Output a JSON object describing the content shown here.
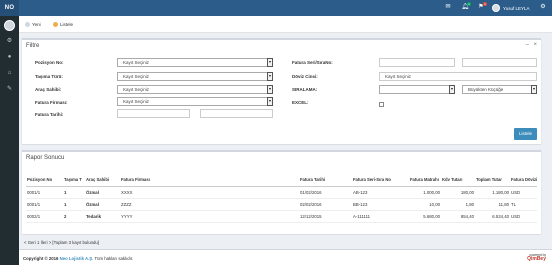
{
  "app": {
    "logo": "NO"
  },
  "topbar": {
    "mail_icon": "envelope-icon",
    "notification_icon": "bell-icon",
    "notification_count": "1",
    "task_icon": "flag-icon",
    "task_count": "1",
    "user_name": "Yusuf LEYLA"
  },
  "sidebar": {
    "icons": [
      "avatar",
      "gear-icon",
      "globe-icon",
      "home-icon",
      "edit-icon"
    ]
  },
  "subbar": {
    "tabs": [
      {
        "label": "Yeni",
        "icon": "new-icon",
        "color": "#cfd8e3"
      },
      {
        "label": "Listele",
        "icon": "list-icon",
        "color": "#f0ad4e"
      }
    ]
  },
  "filter": {
    "title": "Filtre",
    "collapse": "–",
    "close": "×",
    "fields": {
      "pozisyon_no": {
        "label": "Pozisyon No:",
        "value": "Kayıt Seçiniz"
      },
      "tasima_turu": {
        "label": "Taşıma Türü:",
        "value": "Kayıt Seçiniz"
      },
      "arac_sahibi": {
        "label": "Araç Sahibi:",
        "value": "Kayıt Seçiniz"
      },
      "fatura_firmasi": {
        "label": "Fatura Firması:",
        "value": "Kayıt Seçiniz"
      },
      "fatura_tarihi": {
        "label": "Fatura Tarihi:"
      },
      "fatura_seri_sira": {
        "label": "Fatura Seri/SıraNo:"
      },
      "doviz_cinsi": {
        "label": "Döviz Cinsi:",
        "value": "Kayıt Seçiniz"
      },
      "siralama": {
        "label": "SIRALAMA:",
        "order": "Büyükten Küçüğe"
      },
      "excel": {
        "label": "EXCEL:"
      }
    },
    "submit": "Listele"
  },
  "report": {
    "title": "Rapor Sonucu",
    "columns": [
      "Pozisyon No",
      "Taşıma T",
      "Araç Sahibi",
      "Fatura Firması",
      "Fatura Tarihi",
      "Fatura Seri-Sıra No",
      "Fatura Matrahı",
      "Kdv Tutarı",
      "Toplam Tutar",
      "Fatura Dövizi"
    ],
    "rows": [
      [
        "0001/1",
        "1",
        "Özmal",
        "XXXX",
        "01/02/2016",
        "AB-123",
        "1.000,00",
        "180,00",
        "1.180,00",
        "USD"
      ],
      [
        "0001/1",
        "1",
        "Özmal",
        "ZZZZ",
        "02/02/2016",
        "BB-123",
        "10,00",
        "1,80",
        "11,80",
        "TL"
      ],
      [
        "0002/1",
        "2",
        "Tedarik",
        "YYYY",
        "12/12/2015",
        "A-111111",
        "5.680,00",
        "854,40",
        "6.534,40",
        "USD"
      ]
    ]
  },
  "pager": "< Geri 1 İleri > [Toplam 3 kayıt bulundu]",
  "footer": {
    "copyright_prefix": "Copyright © 2016",
    "brand": "Neo Lojistik A.Ş.",
    "suffix": "Tüm hakları saklıdır.",
    "powered_by": "powered by",
    "powered_brand": "QimBey"
  }
}
